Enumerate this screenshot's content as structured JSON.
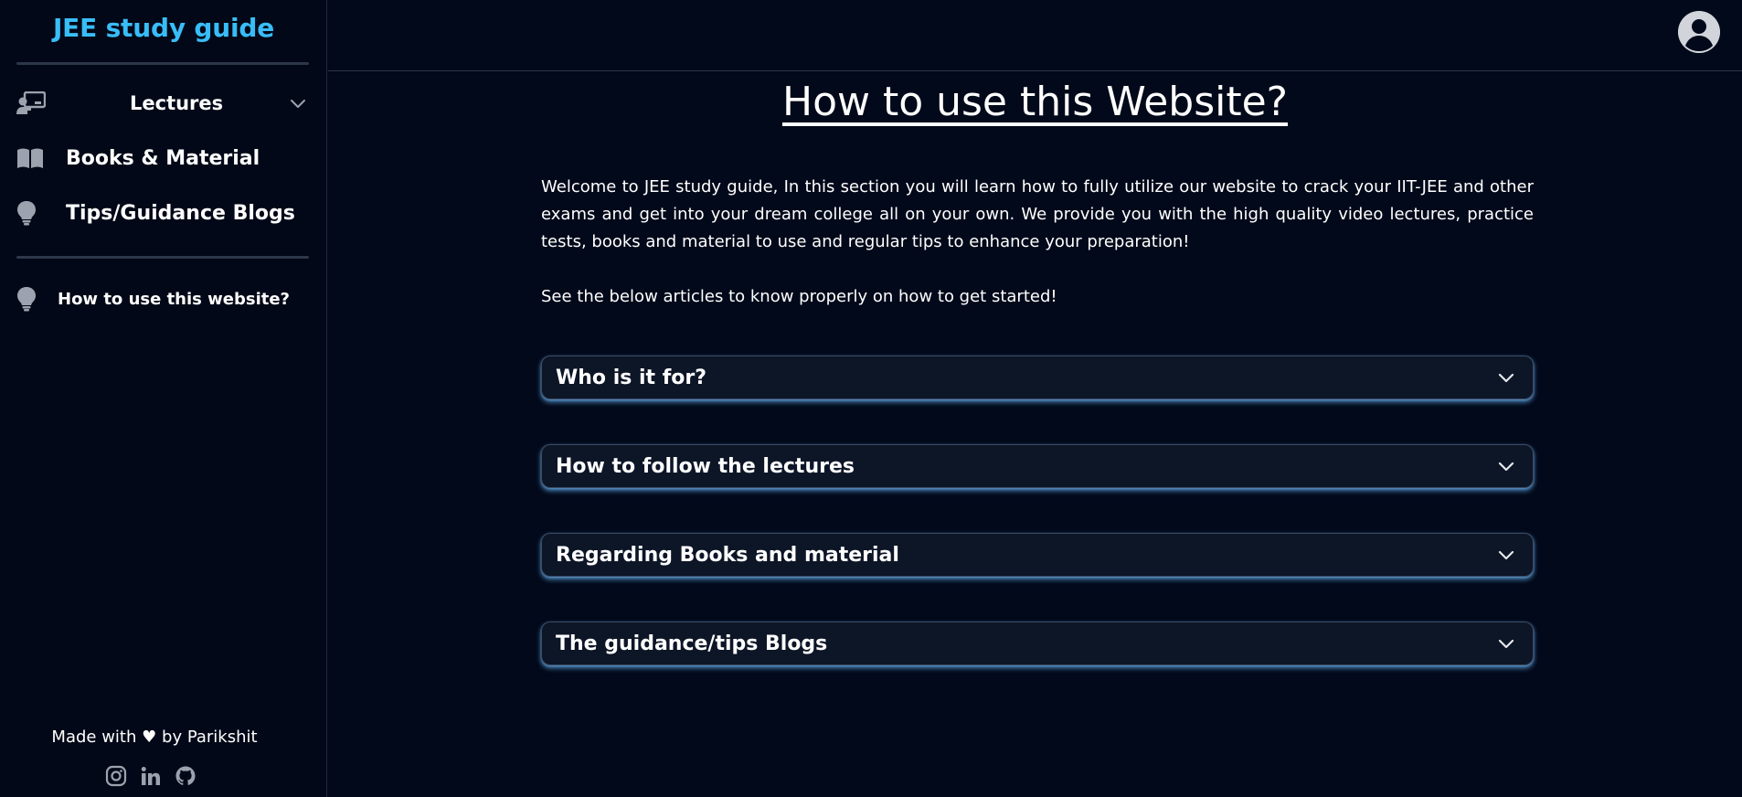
{
  "sidebar": {
    "brand": "JEE study guide",
    "items": [
      {
        "label": "Lectures",
        "icon": "chalkboard-teacher-icon",
        "has_dropdown": true
      },
      {
        "label": "Books & Material",
        "icon": "book-open-icon"
      },
      {
        "label": "Tips/Guidance Blogs",
        "icon": "lightbulb-icon"
      }
    ],
    "secondary_items": [
      {
        "label": "How to use this website?",
        "icon": "lightbulb-icon"
      }
    ],
    "footer": {
      "made_with_prefix": "Made with",
      "heart": "♥",
      "made_with_suffix": "by Parikshit",
      "socials": [
        "instagram-icon",
        "linkedin-icon",
        "github-icon"
      ]
    }
  },
  "topbar": {
    "avatar_icon": "user-circle-icon"
  },
  "main": {
    "title": "How to use this Website?",
    "intro": "Welcome to JEE study guide, In this section you will learn how to fully utilize our website to crack your IIT-JEE and other exams and get into your dream college all on your own. We provide you with the high quality video lectures, practice tests, books and material to use and regular tips to enhance your preparation!",
    "subintro": "See the below articles to know properly on how to get started!",
    "accordions": [
      {
        "label": "Who is it for?"
      },
      {
        "label": "How to follow the lectures"
      },
      {
        "label": "Regarding Books and material"
      },
      {
        "label": "The guidance/tips Blogs"
      }
    ]
  },
  "colors": {
    "background": "#02091a",
    "brand": "#38bdf8",
    "accordion_bg": "#0d1627",
    "accordion_glow": "#60aae6"
  }
}
